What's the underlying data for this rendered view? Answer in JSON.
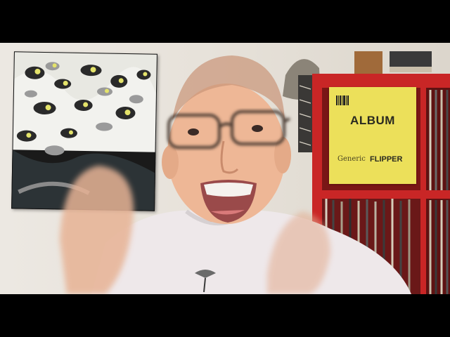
{
  "scene": {
    "description_colors": {
      "wall": "#e9e4dc",
      "shelf_red": "#d42a2a",
      "album_yellow": "#ece05a",
      "shirt": "#efe9ea",
      "letterbox": "#000000"
    }
  },
  "poster": {
    "title_text": "",
    "icon": "art-poster"
  },
  "album": {
    "title": "ALBUM",
    "artist_prefix": "Generic",
    "artist_name": "FLIPPER"
  }
}
